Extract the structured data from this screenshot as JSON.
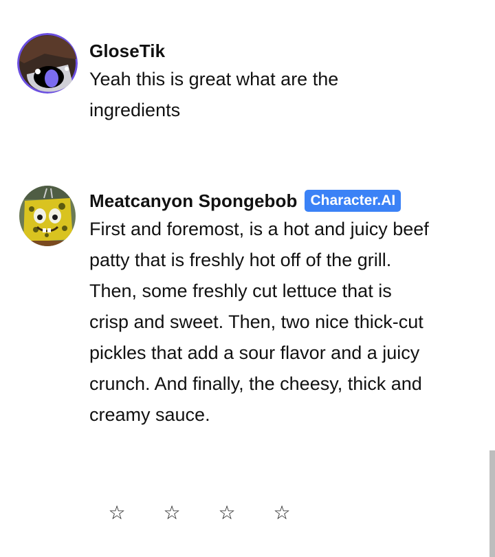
{
  "messages": [
    {
      "author": "GloseTik",
      "text": "Yeah this is great what are the ingredients",
      "avatar_icon": "user-avatar"
    },
    {
      "author": "Meatcanyon Spongebob",
      "badge": "Character.AI",
      "badge_color": "#3b82f6",
      "text": "First and foremost, is a hot and juicy beef patty that is freshly hot off of the grill. Then, some freshly cut lettuce that is crisp and sweet. Then, two nice thick-cut pickles that add a sour flavor and a juicy crunch. And finally, the cheesy, thick and creamy sauce.",
      "avatar_icon": "character-avatar"
    }
  ],
  "rating": {
    "stars": [
      "☆",
      "☆",
      "☆",
      "☆"
    ],
    "selected": 0
  }
}
